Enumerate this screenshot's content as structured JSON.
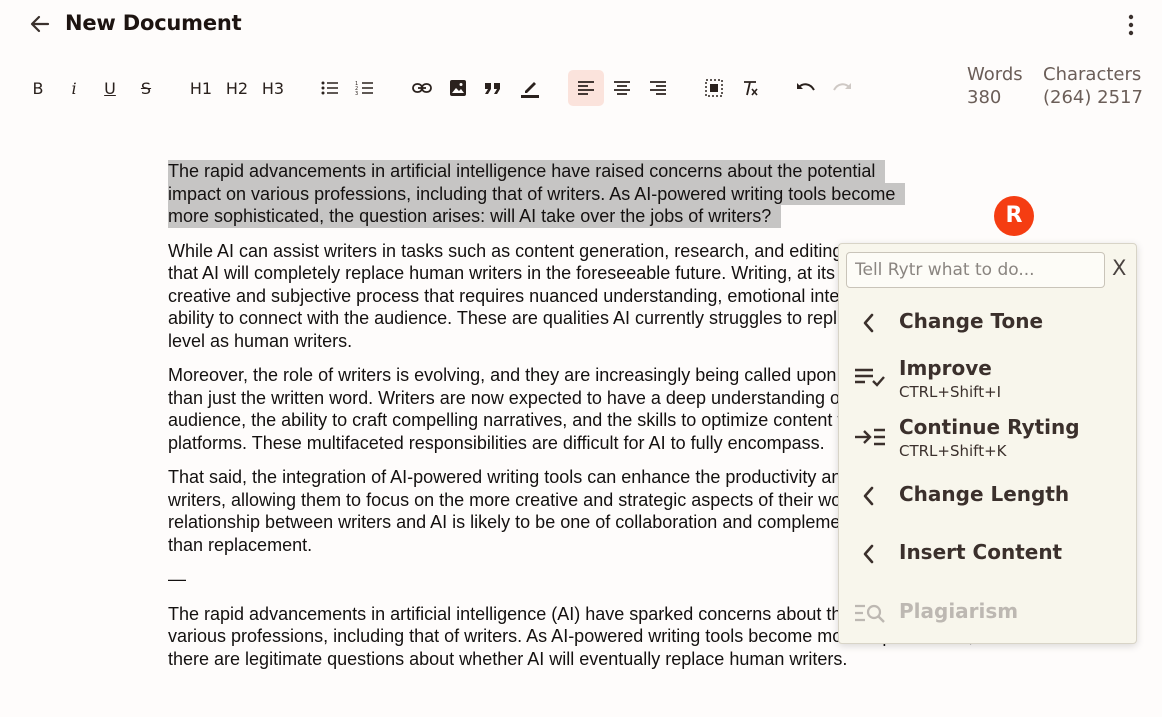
{
  "header": {
    "title": "New Document"
  },
  "toolbar": {
    "bold": "B",
    "italic": "i",
    "underline": "U",
    "strike": "S",
    "h1": "H1",
    "h2": "H2",
    "h3": "H3"
  },
  "stats": {
    "words_label": "Words",
    "words_value": "380",
    "chars_label": "Characters",
    "chars_value": "(264) 2517"
  },
  "editor": {
    "selected_lines": [
      "The rapid advancements in artificial intelligence have raised concerns about the potential",
      "impact on various professions, including that of writers. As AI-powered writing tools become",
      "more sophisticated, the question arises: will AI take over the jobs of writers?"
    ],
    "p2": "While AI can assist writers in tasks such as content generation, research, and editing, it is unlikely that AI will completely replace human writers in the foreseeable future. Writing, at its core, is a creative and subjective process that requires nuanced understanding, emotional intelligence, and the ability to connect with the audience. These are qualities AI currently struggles to replicate at the same level as human writers.",
    "p3": "Moreover, the role of writers is evolving, and they are increasingly being called upon to provide more than just the written word. Writers are now expected to have a deep understanding of their target audience, the ability to craft compelling narratives, and the skills to optimize content for various digital platforms. These multifaceted responsibilities are difficult for AI to fully encompass.",
    "p4": "That said, the integration of AI-powered writing tools can enhance the productivity and efficiency of writers, allowing them to focus on the more creative and strategic aspects of their work. As such, the relationship between writers and AI is likely to be one of collaboration and complementarity, rather than replacement.",
    "separator": "—",
    "p5": "The rapid advancements in artificial intelligence (AI) have sparked concerns about the future of various professions, including that of writers. As AI-powered writing tools become more sophisticated, there are legitimate questions about whether AI will eventually replace human writers."
  },
  "rytr": {
    "badge_letter": "R",
    "prompt_placeholder": "Tell Rytr what to do...",
    "close_label": "X",
    "menu": {
      "change_tone": "Change Tone",
      "improve": "Improve",
      "improve_shortcut": "CTRL+Shift+I",
      "continue": "Continue Ryting",
      "continue_shortcut": "CTRL+Shift+K",
      "change_length": "Change Length",
      "insert_content": "Insert Content",
      "plagiarism": "Plagiarism"
    }
  },
  "colors": {
    "accent": "#f53d12",
    "selection": "#c6c5c4",
    "active_tool": "#fbe3dc",
    "popup_bg": "#f8f6ec"
  }
}
